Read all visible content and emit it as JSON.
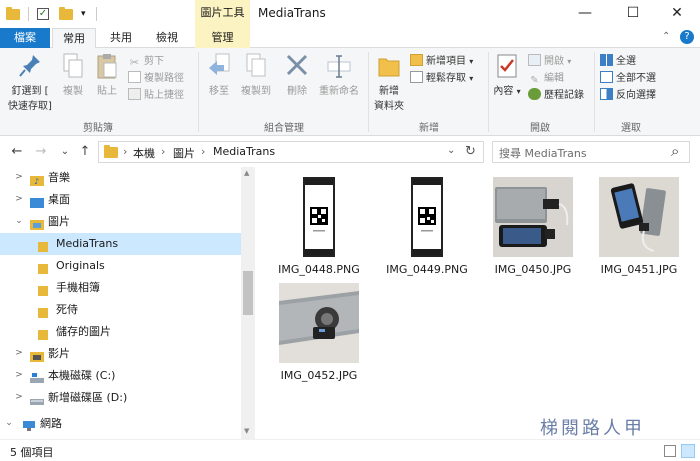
{
  "window": {
    "title": "MediaTrans",
    "context_tab_group": "圖片工具",
    "minimize_glyph": "—",
    "maximize_glyph": "☐",
    "close_glyph": "✕",
    "qat_dropdown_glyph": "▾"
  },
  "tabs": {
    "file": "檔案",
    "home": "常用",
    "share": "共用",
    "view": "檢視",
    "manage": "管理",
    "help_glyph": "?",
    "collapse_glyph": "⌃"
  },
  "ribbon": {
    "clipboard": {
      "label": "剪貼簿",
      "pin_line1": "釘選到 [",
      "pin_line2": "快速存取]",
      "copy": "複製",
      "paste": "貼上",
      "cut": "剪下",
      "copy_path": "複製路徑",
      "paste_shortcut": "貼上捷徑"
    },
    "organize": {
      "label": "組合管理",
      "move_to": "移至",
      "copy_to": "複製到",
      "delete": "刪除",
      "rename": "重新命名"
    },
    "new": {
      "label": "新增",
      "new_folder_line1": "新增",
      "new_folder_line2": "資料夾",
      "new_item": "新增項目",
      "easy_access": "輕鬆存取"
    },
    "open": {
      "label": "開啟",
      "properties": "內容",
      "open": "開啟",
      "edit": "編輯",
      "history": "歷程記錄"
    },
    "select": {
      "label": "選取",
      "select_all": "全選",
      "select_none": "全部不選",
      "invert": "反向選擇"
    }
  },
  "address": {
    "back_glyph": "←",
    "forward_glyph": "→",
    "recent_glyph": "⌄",
    "up_glyph": "↑",
    "separator": "›",
    "crumbs": [
      "本機",
      "圖片",
      "MediaTrans"
    ],
    "dropdown_glyph": "⌄",
    "refresh_glyph": "↻",
    "search_placeholder": "搜尋 MediaTrans",
    "search_glyph": "⌕"
  },
  "nav": {
    "items": [
      {
        "label": "音樂"
      },
      {
        "label": "桌面"
      },
      {
        "label": "圖片"
      },
      {
        "label": "MediaTrans"
      },
      {
        "label": "Originals"
      },
      {
        "label": "手機相簿"
      },
      {
        "label": "死侍"
      },
      {
        "label": "儲存的圖片"
      },
      {
        "label": "影片"
      },
      {
        "label": "本機磁碟 (C:)"
      },
      {
        "label": "新增磁碟區 (D:)"
      },
      {
        "label": "網路"
      }
    ],
    "selected": "MediaTrans",
    "chevron_collapsed": ">",
    "chevron_expanded": "⌄"
  },
  "files": [
    {
      "name": "IMG_0448.PNG"
    },
    {
      "name": "IMG_0449.PNG"
    },
    {
      "name": "IMG_0450.JPG"
    },
    {
      "name": "IMG_0451.JPG"
    },
    {
      "name": "IMG_0452.JPG"
    }
  ],
  "status": {
    "item_count": "5 個項目"
  },
  "watermark": "梯閱路人甲",
  "colors": {
    "file_tab": "#1979ca",
    "context_tab": "#fbf4c2",
    "selection": "#cce8ff",
    "folder": "#e8b83a"
  }
}
